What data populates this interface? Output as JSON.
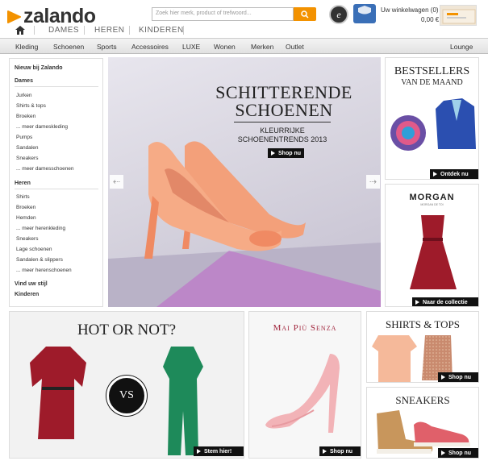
{
  "header": {
    "logo_text": "zalando",
    "search_placeholder": "Zoek hier merk, product of trefwoord...",
    "trust_badge": "e",
    "cart_label": "Uw winkelwagen (0)",
    "cart_price": "0,00 €"
  },
  "topnav": {
    "tabs": [
      "DAMES",
      "HEREN",
      "KINDEREN"
    ]
  },
  "mainnav": {
    "items": [
      "Kleding",
      "Schoenen",
      "Sports",
      "Accessoires",
      "LUXE",
      "Wonen",
      "Merken",
      "Outlet",
      "Lounge"
    ]
  },
  "sidebar": {
    "new": "Nieuw bij Zalando",
    "dames_title": "Dames",
    "dames": [
      "Jurken",
      "Shirts & tops",
      "Broeken",
      "... meer dameskleding",
      "Pumps",
      "Sandalen",
      "Sneakers",
      "... meer damesschoenen"
    ],
    "heren_title": "Heren",
    "heren": [
      "Shirts",
      "Broeken",
      "Hemden",
      "... meer herenkleding",
      "Sneakers",
      "Lage schoenen",
      "Sandalen & slippers",
      "... meer herenschoenen"
    ],
    "style": "Vind uw stijl",
    "kids": "Kinderen"
  },
  "hero": {
    "title_1": "SCHITTERENDE",
    "title_2": "SCHOENEN",
    "sub_1": "KLEURRIJKE",
    "sub_2": "SCHOENENTRENDS 2013",
    "cta": "Shop nu"
  },
  "bestsellers": {
    "title": "BESTSELLERS",
    "subtitle": "VAN DE MAAND",
    "cta": "Ontdek nu"
  },
  "morgan": {
    "brand": "MORGAN",
    "tagline": "MORGAN DE TOI",
    "cta": "Naar de collectie"
  },
  "hotornot": {
    "title": "HOT OR NOT?",
    "vs": "VS",
    "cta": "Stem hier!"
  },
  "maipiu": {
    "title": "Mai Più Senza",
    "cta": "Shop nu"
  },
  "shirts": {
    "title": "SHIRTS & TOPS",
    "cta": "Shop nu"
  },
  "sneakers": {
    "title": "SNEAKERS",
    "cta": "Shop nu"
  },
  "colors": {
    "brand_orange": "#f39200",
    "coral_shoe": "#f4a27a",
    "dress_red": "#9e1b2a",
    "jumpsuit_green": "#1e8a5a"
  }
}
